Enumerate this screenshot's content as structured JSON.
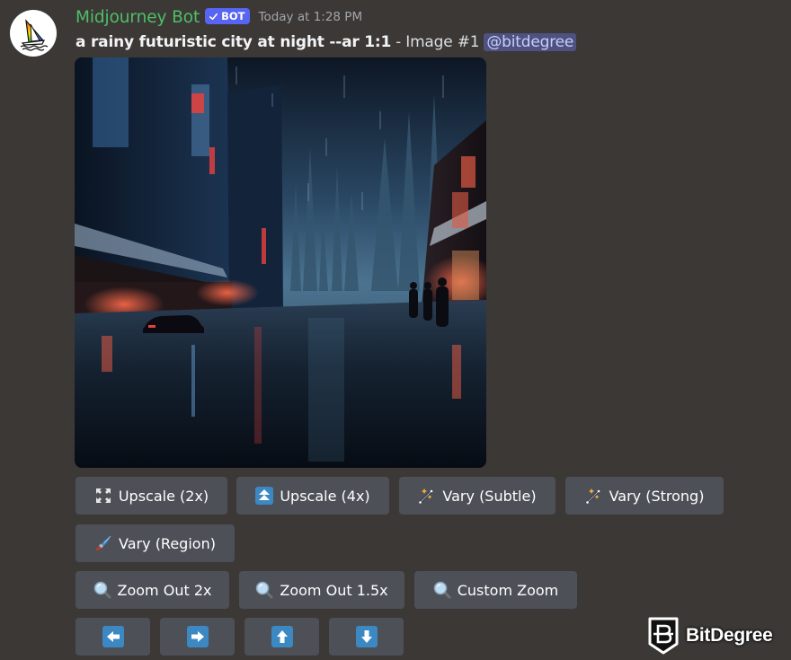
{
  "message": {
    "author": {
      "name": "Midjourney Bot",
      "name_color": "#4fbf67",
      "avatar_icon": "sailboat-rainbow-logo"
    },
    "badge": {
      "label": "BOT",
      "verified": true,
      "color": "#5865f2"
    },
    "timestamp": "Today at 1:28 PM",
    "prompt": "a rainy futuristic city at night --ar 1:1",
    "image_label": "- Image #1",
    "mention": "@bitdegree",
    "image": {
      "description": "Rainy futuristic city street at night with neon-lit buildings, wet reflective pavement, a parked car and pedestrians"
    }
  },
  "buttons": {
    "row1": [
      {
        "label": "Upscale (2x)",
        "icon": "expand-corners-icon"
      },
      {
        "label": "Upscale (4x)",
        "icon": "double-up-arrow-icon"
      },
      {
        "label": "Vary (Subtle)",
        "icon": "magic-wand-icon"
      },
      {
        "label": "Vary (Strong)",
        "icon": "magic-wand-icon"
      }
    ],
    "row2": [
      {
        "label": "Vary (Region)",
        "icon": "paintbrush-icon"
      }
    ],
    "row3": [
      {
        "label": "Zoom Out 2x",
        "icon": "magnifier-icon"
      },
      {
        "label": "Zoom Out 1.5x",
        "icon": "magnifier-icon"
      },
      {
        "label": "Custom Zoom",
        "icon": "magnifier-icon"
      }
    ],
    "row4": [
      {
        "label": "Pan left",
        "icon": "arrow-left-icon"
      },
      {
        "label": "Pan right",
        "icon": "arrow-right-icon"
      },
      {
        "label": "Pan up",
        "icon": "arrow-up-icon"
      },
      {
        "label": "Pan down",
        "icon": "arrow-down-icon"
      }
    ]
  },
  "colors": {
    "background": "#3b3836",
    "button": "#4e5058",
    "arrow_tile": "#3b88c3",
    "mention_bg": "#4d5280"
  },
  "watermark": {
    "text": "BitDegree"
  }
}
